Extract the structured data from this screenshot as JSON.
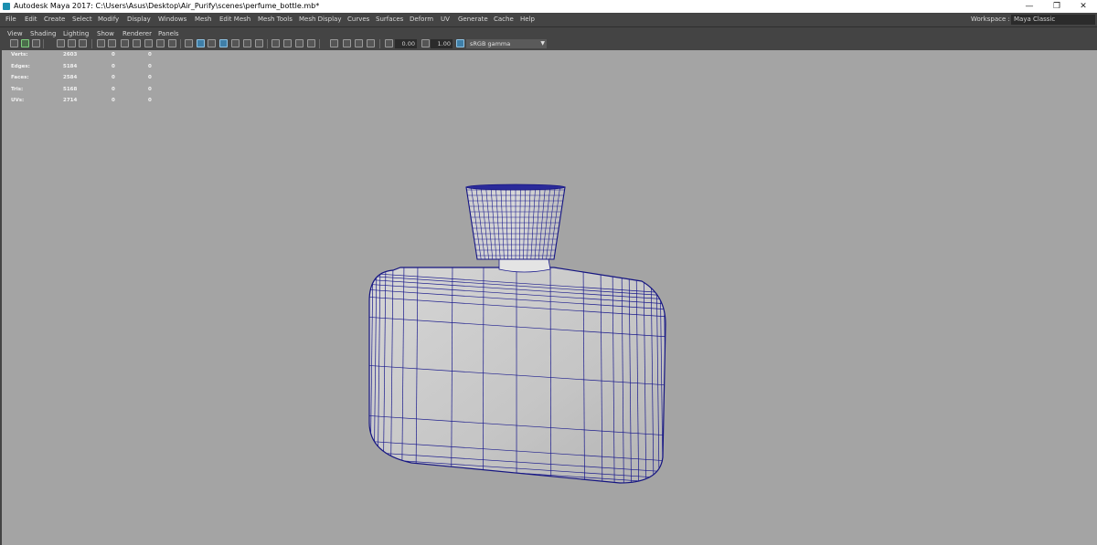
{
  "window": {
    "title": "Autodesk Maya 2017: C:\\Users\\Asus\\Desktop\\Air_Purify\\scenes\\perfume_bottle.mb*",
    "minimize": "—",
    "restore": "❐",
    "close": "✕"
  },
  "menubar": {
    "items": [
      "File",
      "Edit",
      "Create",
      "Select",
      "Modify",
      "Display",
      "Windows",
      "Mesh",
      "Edit Mesh",
      "Mesh Tools",
      "Mesh Display",
      "Curves",
      "Surfaces",
      "Deform",
      "UV",
      "Generate",
      "Cache",
      "Help"
    ],
    "workspace_label": "Workspace :",
    "workspace_value": "Maya Classic"
  },
  "panel_menu": {
    "items": [
      "View",
      "Shading",
      "Lighting",
      "Show",
      "Renderer",
      "Panels"
    ]
  },
  "toolbar": {
    "exposure": "0.00",
    "gamma": "1.00",
    "colorspace": "sRGB gamma"
  },
  "hud": {
    "rows": [
      {
        "label": "Verts:",
        "a": "2603",
        "b": "0",
        "c": "0"
      },
      {
        "label": "Edges:",
        "a": "5184",
        "b": "0",
        "c": "0"
      },
      {
        "label": "Faces:",
        "a": "2584",
        "b": "0",
        "c": "0"
      },
      {
        "label": "Tris:",
        "a": "5168",
        "b": "0",
        "c": "0"
      },
      {
        "label": "UVs:",
        "a": "2714",
        "b": "0",
        "c": "0"
      }
    ]
  },
  "colors": {
    "viewport_bg": "#a4a4a4",
    "wireframe": "#1a1a8c",
    "mesh_fill": "#c8c8c8",
    "ui_bg": "#444444",
    "accent": "#3f7fa8"
  },
  "icons": {
    "app": "maya-logo-icon",
    "exposure": "exposure-icon",
    "colorspace": "color-management-icon"
  }
}
